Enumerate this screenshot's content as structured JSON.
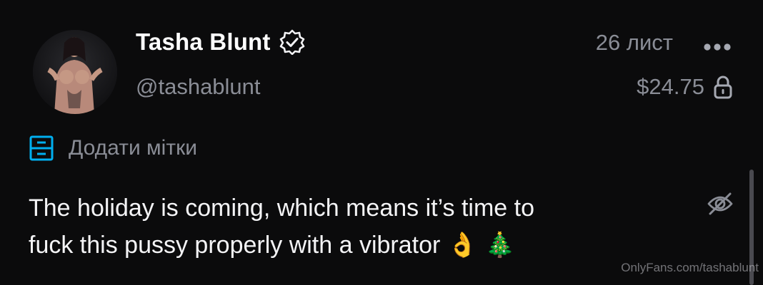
{
  "post": {
    "author": {
      "display_name": "Tasha Blunt",
      "username": "@tashablunt",
      "verified": true
    },
    "date": "26 лист",
    "price": "$24.75",
    "locked": true,
    "tags_action_label": "Додати мітки",
    "text_line_1": "The holiday is coming, which means it’s time to",
    "text_line_2": "fuck this pussy properly with a vibrator",
    "emoji_1": "👌",
    "emoji_2": "🎄"
  },
  "icons": {
    "verified": "verified-badge-icon",
    "more": "more-options-icon",
    "lock": "lock-icon",
    "tags": "tag-list-icon",
    "hide": "eye-slash-icon"
  },
  "colors": {
    "background": "#0b0b0c",
    "primary_text": "#f2f2f4",
    "secondary_text": "#8a8d96",
    "accent": "#00aff0"
  },
  "watermark": "OnlyFans.com/tashablunt"
}
